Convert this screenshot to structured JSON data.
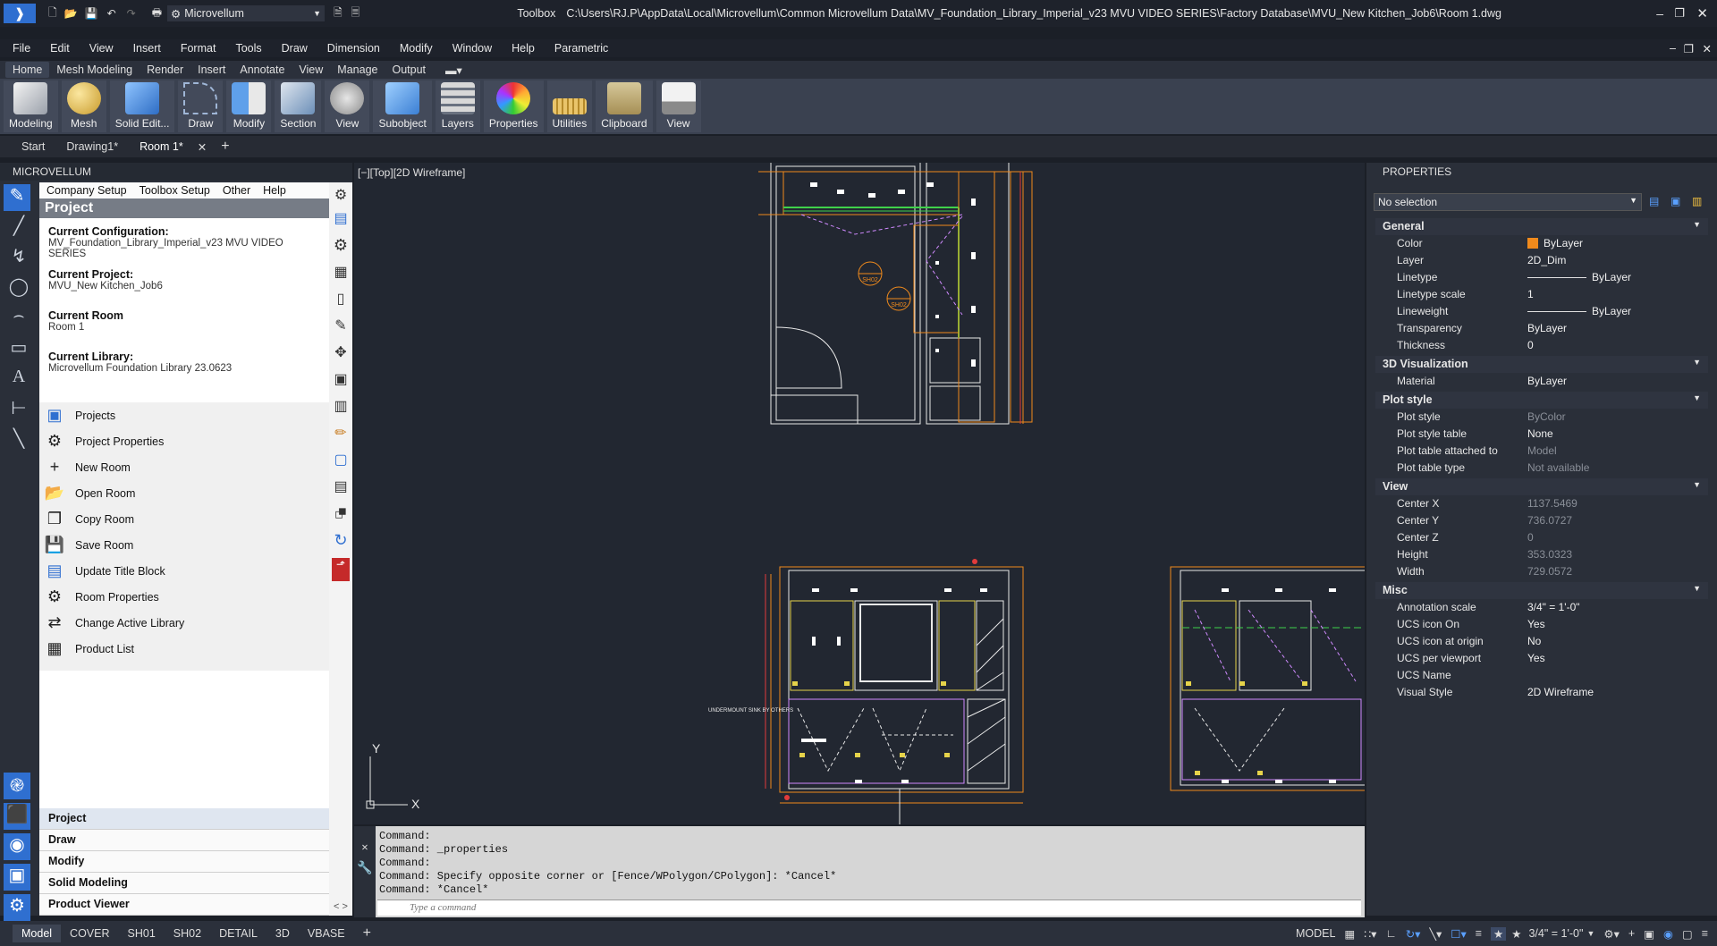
{
  "titlebar": {
    "workspace": "Microvellum",
    "app_name": "Toolbox",
    "file_path": "C:\\Users\\RJ.P\\AppData\\Local\\Microvellum\\Common Microvellum Data\\MV_Foundation_Library_Imperial_v23 MVU VIDEO SERIES\\Factory Database\\MVU_New Kitchen_Job6\\Room 1.dwg"
  },
  "menubar": [
    "File",
    "Edit",
    "View",
    "Insert",
    "Format",
    "Tools",
    "Draw",
    "Dimension",
    "Modify",
    "Window",
    "Help",
    "Parametric"
  ],
  "ribbon_tabs": [
    "Home",
    "Mesh Modeling",
    "Render",
    "Insert",
    "Annotate",
    "View",
    "Manage",
    "Output"
  ],
  "ribbon_active": "Home",
  "ribbon_buttons": [
    "Modeling",
    "Mesh",
    "Solid Edit...",
    "Draw",
    "Modify",
    "Section",
    "View",
    "Subobject",
    "Layers",
    "Properties",
    "Utilities",
    "Clipboard",
    "View"
  ],
  "doc_tabs": [
    "Start",
    "Drawing1*",
    "Room 1*"
  ],
  "doc_tab_active": "Room 1*",
  "palette": {
    "title": "MICROVELLUM",
    "menu": [
      "Company Setup",
      "Toolbox Setup",
      "Other",
      "Help"
    ],
    "section_title": "Project",
    "current_configuration_label": "Current Configuration:",
    "current_configuration": "MV_Foundation_Library_Imperial_v23 MVU VIDEO SERIES",
    "current_project_label": "Current Project:",
    "current_project": "MVU_New Kitchen_Job6",
    "current_room_label": "Current Room",
    "current_room": "Room 1",
    "current_library_label": "Current Library:",
    "current_library": "Microvellum Foundation Library 23.0623",
    "actions": [
      "Projects",
      "Project Properties",
      "New Room",
      "Open Room",
      "Copy Room",
      "Save Room",
      "Update Title Block",
      "Room Properties",
      "Change Active Library",
      "Product List"
    ],
    "sections": [
      "Project",
      "Draw",
      "Modify",
      "Solid Modeling",
      "Product Viewer"
    ],
    "section_active": "Project"
  },
  "viewport_label": "[−][Top][2D Wireframe]",
  "drawing_annotations": {
    "undermount": "UNDERMOUNT SINK BY OTHERS",
    "sh02": "SH02",
    "axis_y": "Y",
    "axis_x": "X"
  },
  "command": {
    "lines": [
      "Command:",
      "Command: _properties",
      "Command:",
      "Command: Specify opposite corner or [Fence/WPolygon/CPolygon]: *Cancel*",
      "Command: *Cancel*"
    ],
    "placeholder": "Type a command"
  },
  "properties": {
    "title": "PROPERTIES",
    "selection": "No selection",
    "groups": [
      {
        "name": "General",
        "rows": [
          {
            "k": "Color",
            "v": "ByLayer",
            "swatch": "#f08a1c"
          },
          {
            "k": "Layer",
            "v": "2D_Dim"
          },
          {
            "k": "Linetype",
            "v": "ByLayer",
            "line": true
          },
          {
            "k": "Linetype scale",
            "v": "1"
          },
          {
            "k": "Lineweight",
            "v": "ByLayer",
            "line": true
          },
          {
            "k": "Transparency",
            "v": "ByLayer"
          },
          {
            "k": "Thickness",
            "v": "0"
          }
        ]
      },
      {
        "name": "3D Visualization",
        "rows": [
          {
            "k": "Material",
            "v": "ByLayer"
          }
        ]
      },
      {
        "name": "Plot style",
        "rows": [
          {
            "k": "Plot style",
            "v": "ByColor",
            "dim": true
          },
          {
            "k": "Plot style table",
            "v": "None"
          },
          {
            "k": "Plot table attached to",
            "v": "Model",
            "dim": true
          },
          {
            "k": "Plot table type",
            "v": "Not available",
            "dim": true
          }
        ]
      },
      {
        "name": "View",
        "rows": [
          {
            "k": "Center X",
            "v": "1137.5469",
            "dim": true
          },
          {
            "k": "Center Y",
            "v": "736.0727",
            "dim": true
          },
          {
            "k": "Center Z",
            "v": "0",
            "dim": true
          },
          {
            "k": "Height",
            "v": "353.0323",
            "dim": true
          },
          {
            "k": "Width",
            "v": "729.0572",
            "dim": true
          }
        ]
      },
      {
        "name": "Misc",
        "rows": [
          {
            "k": "Annotation scale",
            "v": "3/4\" = 1'-0\""
          },
          {
            "k": "UCS icon On",
            "v": "Yes"
          },
          {
            "k": "UCS icon at origin",
            "v": "No"
          },
          {
            "k": "UCS per viewport",
            "v": "Yes"
          },
          {
            "k": "UCS Name",
            "v": ""
          },
          {
            "k": "Visual Style",
            "v": "2D Wireframe"
          }
        ]
      }
    ]
  },
  "layout_tabs": [
    "Model",
    "COVER",
    "SH01",
    "SH02",
    "DETAIL",
    "3D",
    "VBASE"
  ],
  "layout_active": "Model",
  "status": {
    "mode": "MODEL",
    "annotation_scale": "3/4\" = 1'-0\""
  },
  "colors": {
    "accent": "#3a7bd5",
    "cad_orange": "#f08a1c",
    "cad_green": "#3fd14a",
    "cad_yellow": "#e6d34a",
    "cad_white": "#e8e8e8",
    "cad_red": "#e23b3b"
  }
}
